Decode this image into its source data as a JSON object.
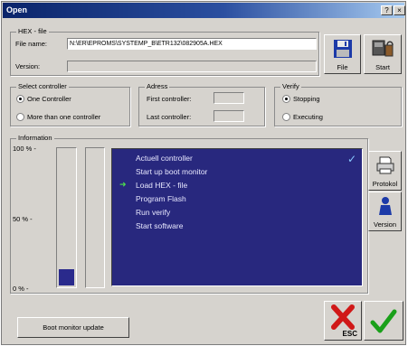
{
  "window": {
    "title": "Open",
    "close_glyph": "×",
    "help_glyph": "?"
  },
  "hex_file": {
    "group_label": "HEX - file",
    "file_name_label": "File name:",
    "file_name_value": "N:\\ER\\EPROMS\\SYSTEMP_B\\ETR132\\082905A.HEX",
    "version_label": "Version:",
    "version_value": ""
  },
  "buttons": {
    "file": "File",
    "start": "Start",
    "protokol": "Protokol",
    "version": "Version",
    "boot_monitor_update": "Boot monitor update",
    "esc": "ESC"
  },
  "select_controller": {
    "group_label": "Select controller",
    "options": [
      {
        "label": "One Controller",
        "selected": true
      },
      {
        "label": "More than one controller",
        "selected": false
      }
    ]
  },
  "adress": {
    "group_label": "Adress",
    "first_label": "First controller:",
    "first_value": "",
    "last_label": "Last controller:",
    "last_value": ""
  },
  "verify": {
    "group_label": "Verify",
    "options": [
      {
        "label": "Stopping",
        "selected": true
      },
      {
        "label": "Executing",
        "selected": false
      }
    ]
  },
  "information": {
    "group_label": "Information",
    "progress_fraction": 0.12,
    "y_ticks": [
      "100 % -",
      "50 % -",
      "0 % -"
    ],
    "steps": [
      "Actuell controller",
      "Start up boot monitor",
      "Load HEX - file",
      "Program Flash",
      "Run verify",
      "Start software"
    ],
    "current_step_index": 2
  },
  "icons": {
    "file": "floppy-disk-icon",
    "start": "controller-start-icon",
    "protokol": "printer-icon",
    "version": "person-icon",
    "esc": "red-x-icon",
    "ok": "green-check-icon"
  },
  "colors": {
    "panel": "#28287e",
    "progress": "#2a2a8c",
    "titlebar": "#0a246a",
    "check": "#1aa01a",
    "esc": "#d01818"
  }
}
